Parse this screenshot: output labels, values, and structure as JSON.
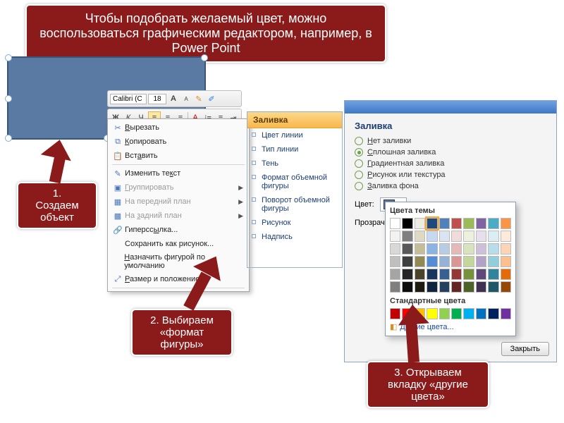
{
  "top_callout": "Чтобы подобрать желаемый цвет, можно воспользоваться графическим редактором, например, в Power Point",
  "step1": "1.\nСоздаем объект",
  "step2": "2. Выбираем «формат фигуры»",
  "step3": "3. Открываем вкладку «другие цвета»",
  "toolbar": {
    "font": "Calibri (С",
    "size": "18",
    "bold": "Ж",
    "italic": "К",
    "underline": "Ч"
  },
  "ctx": {
    "cut": "Вырезать",
    "copy": "Копировать",
    "paste": "Вставить",
    "edit_text": "Изменить текст",
    "group": "Группировать",
    "bring_front": "На передний план",
    "send_back": "На задний план",
    "hyperlink": "Гиперссылка...",
    "save_pic": "Сохранить как рисунок...",
    "set_default": "Назначить фигурой по умолчанию",
    "size_pos": "Размер и положение..."
  },
  "sidepanel": {
    "header": "Заливка",
    "fill_color": "Цвет линии",
    "line_type": "Тип линии",
    "shadow": "Тень",
    "format3d": "Формат объемной фигуры",
    "rotate3d": "Поворот объемной фигуры",
    "picture": "Рисунок",
    "caption": "Надпись"
  },
  "dlg": {
    "title": "Заливка",
    "r_none": "Нет заливки",
    "r_solid": "Сплошная заливка",
    "r_grad": "Градиентная заливка",
    "r_pic": "Рисунок или текстура",
    "r_bg": "Заливка фона",
    "color_lbl": "Цвет:",
    "transp_lbl": "Прозрач",
    "close": "Закрыть"
  },
  "popup": {
    "theme": "Цвета темы",
    "standard": "Стандартные цвета",
    "more": "Другие цвета..."
  }
}
